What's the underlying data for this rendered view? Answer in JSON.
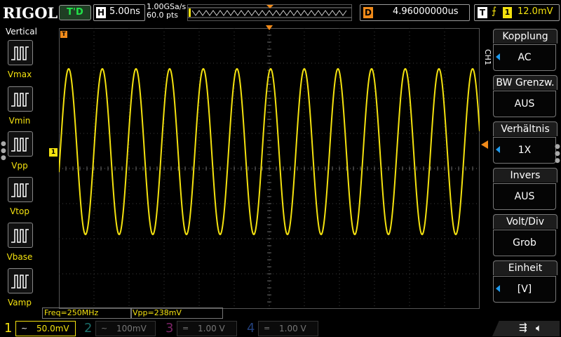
{
  "header": {
    "logo": "RIGOL",
    "trigger_status": "T'D",
    "horizontal_label": "H",
    "timebase": "5.00ns",
    "sample_rate": "1.00GSa/s",
    "memory_depth": "60.0 pts",
    "delay_label": "D",
    "delay": "4.96000000us",
    "trigger_label": "T",
    "trigger_source": "1",
    "trigger_level": "12.0mV"
  },
  "left_panel": {
    "title": "Vertical",
    "buttons": [
      {
        "label": "Vmax"
      },
      {
        "label": "Vmin"
      },
      {
        "label": "Vpp"
      },
      {
        "label": "Vtop"
      },
      {
        "label": "Vbase"
      },
      {
        "label": "Vamp"
      }
    ]
  },
  "right_panel": {
    "tab": "CH1",
    "menu": [
      {
        "title": "Kopplung",
        "value": "AC",
        "has_arrow": true
      },
      {
        "title": "BW Grenzw.",
        "value": "AUS",
        "has_arrow": false
      },
      {
        "title": "Verhältnis",
        "value": "1X",
        "has_arrow": true
      },
      {
        "title": "Invers",
        "value": "AUS",
        "has_arrow": false
      },
      {
        "title": "Volt/Div",
        "value": "Grob",
        "has_arrow": false
      },
      {
        "title": "Einheit",
        "value": "[V]",
        "has_arrow": true
      }
    ]
  },
  "markers": {
    "channel_marker": "1",
    "trigger_position_marker": "T"
  },
  "measurements": {
    "freq": "Freq=250MHz",
    "vpp": "Vpp=238mV"
  },
  "channels": [
    {
      "num": "1",
      "coupling": "~",
      "scale": "50.0mV",
      "active": true,
      "color": "#f4e20f"
    },
    {
      "num": "2",
      "coupling": "~",
      "scale": "100mV",
      "active": false,
      "color": "#1b6e6a"
    },
    {
      "num": "3",
      "coupling": "=",
      "scale": "1.00 V",
      "active": false,
      "color": "#7b2466"
    },
    {
      "num": "4",
      "coupling": "=",
      "scale": "1.00 V",
      "active": false,
      "color": "#23407a"
    }
  ],
  "status_icons": [
    "usb-icon",
    "speaker-mute-icon"
  ],
  "colors": {
    "ch1": "#f4e20f",
    "trigger_status": "#22e34a",
    "delay_marker": "#f08a1a",
    "selector_arrow": "#1e9bf0"
  },
  "waveform": {
    "type": "sine",
    "frequency": "250MHz",
    "vpp": "238mV",
    "cycles_on_screen": 12.5
  }
}
